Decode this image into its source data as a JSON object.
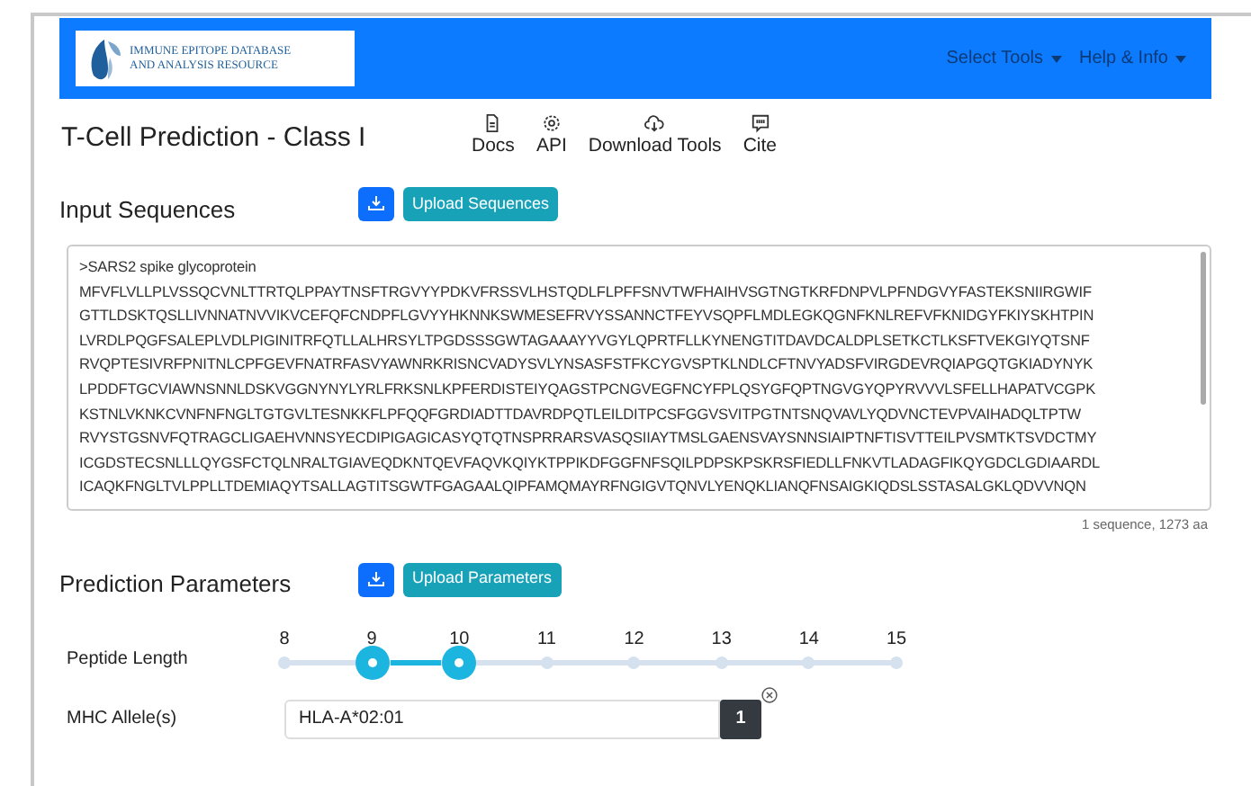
{
  "header": {
    "logo_text": [
      "IMMUNE EPITOPE DATABASE",
      "AND ANALYSIS RESOURCE"
    ],
    "menus": [
      {
        "label": "Select Tools"
      },
      {
        "label": "Help & Info"
      }
    ]
  },
  "page_title": "T-Cell Prediction - Class I",
  "nav_links": [
    {
      "kind": "docs",
      "label": "Docs"
    },
    {
      "kind": "api",
      "label": "API"
    },
    {
      "kind": "download",
      "label": "Download Tools"
    },
    {
      "kind": "cite",
      "label": "Cite"
    }
  ],
  "input_sequences": {
    "heading": "Input Sequences",
    "upload_button": "Upload Sequences",
    "lines": [
      ">SARS2 spike glycoprotein",
      "MFVFLVLLPLVSSQCVNLTTRTQLPPAYTNSFTRGVYYPDKVFRSSVLHSTQDLFLPFFSNVTWFHAIHVSGTNGTKRFDNPVLPFNDGVYFASTEKSNIIRGWIF",
      "GTTLDSKTQSLLIVNNATNVVIKVCEFQFCNDPFLGVYYHKNNKSWMESEFRVYSSANNCTFEYVSQPFLMDLEGKQGNFKNLREFVFKNIDGYFKIYSKHTPIN",
      "LVRDLPQGFSALEPLVDLPIGINITRFQTLLALHRSYLTPGDSSSGWTAGAAAYYVGYLQPRTFLLKYNENGTITDAVDCALDPLSETKCTLKSFTVEKGIYQTSNF",
      "RVQPTESIVRFPNITNLCPFGEVFNATRFASVYAWNRKRISNCVADYSVLYNSASFSTFKCYGVSPTKLNDLCFTNVYADSFVIRGDEVRQIAPGQTGKIADYNYK",
      "LPDDFTGCVIAWNSNNLDSKVGGNYNYLYRLFRKSNLKPFERDISTEIYQAGSTPCNGVEGFNCYFPLQSYGFQPTNGVGYQPYRVVVLSFELLHAPATVCGPK",
      "KSTNLVKNKCVNFNFNGLTGTGVLTESNKKFLPFQQFGRDIADTTDAVRDPQTLEILDITPCSFGGVSVITPGTNTSNQVAVLYQDVNCTEVPVAIHADQLTPTW",
      "RVYSTGSNVFQTRAGCLIGAEHVNNSYECDIPIGAGICASYQTQTNSPRRARSVASQSIIAYTMSLGAENSVAYSNNSIAIPTNFTISVTTEILPVSMTKTSVDCTMY",
      "ICGDSTECSNLLLQYGSFCTQLNRALTGIAVEQDKNTQEVFAQVKQIYKTPPIKDFGGFNFSQILPDPSKPSKRSFIEDLLFNKVTLADAGFIKQYGDCLGDIAARDL",
      "ICAQKFNGLTVLPPLLTDEMIAQYTSALLAGTITSGWTFGAGAALQIPFAMQMAYRFNGIGVTQNVLYENQKLIANQFNSAIGKIQDSLSSTASALGKLQDVVNQN"
    ],
    "summary": "1 sequence, 1273 aa"
  },
  "prediction_parameters": {
    "heading": "Prediction Parameters",
    "upload_button": "Upload Parameters",
    "peptide_length": {
      "label": "Peptide Length",
      "ticks": [
        {
          "label": "8",
          "selected": false
        },
        {
          "label": "9",
          "selected": true
        },
        {
          "label": "10",
          "selected": true
        },
        {
          "label": "11",
          "selected": false
        },
        {
          "label": "12",
          "selected": false
        },
        {
          "label": "13",
          "selected": false
        },
        {
          "label": "14",
          "selected": false
        },
        {
          "label": "15",
          "selected": false
        }
      ]
    },
    "mhc_allele": {
      "label": "MHC Allele(s)",
      "value": "HLA-A*02:01",
      "count": "1"
    }
  }
}
